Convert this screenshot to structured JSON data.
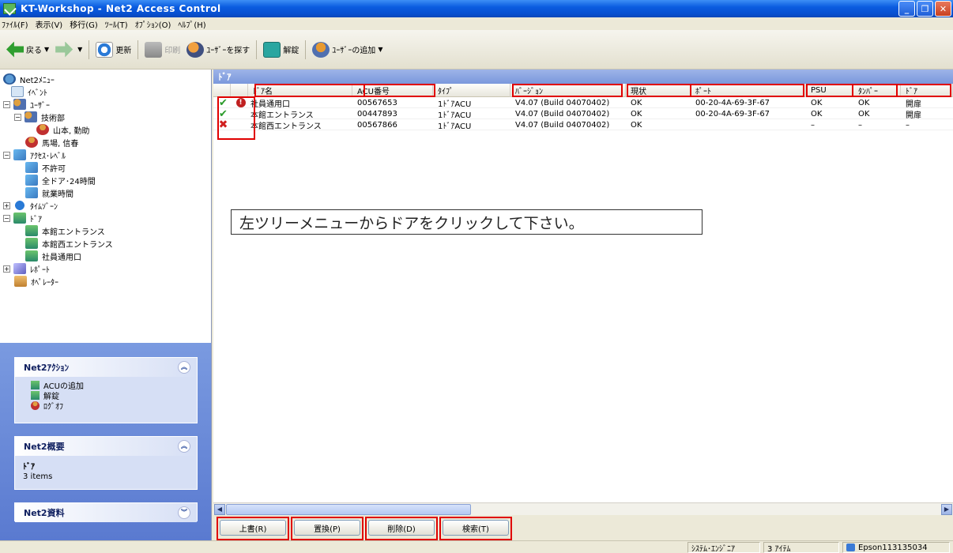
{
  "window": {
    "title": "KT-Workshop - Net2 Access Control"
  },
  "menubar": [
    "ﾌｧｲﾙ(F)",
    "表示(V)",
    "移行(G)",
    "ﾂｰﾙ(T)",
    "ｵﾌﾟｼｮﾝ(O)",
    "ﾍﾙﾌﾟ(H)"
  ],
  "toolbar": {
    "back": "戻る",
    "refresh": "更新",
    "print": "印刷",
    "find_user": "ﾕｰｻﾞｰを探す",
    "unlock": "解錠",
    "add_user": "ﾕｰｻﾞｰの追加"
  },
  "tree": {
    "root": "Net2ﾒﾆｭｰ",
    "event": "ｲﾍﾞﾝﾄ",
    "users": "ﾕｰｻﾞｰ",
    "tech_dept": "技術部",
    "user1": "山本, 勤助",
    "user2": "馬場, 信春",
    "access_level": "ｱｸｾｽ･ﾚﾍﾞﾙ",
    "al1": "不許可",
    "al2": "全ドア･24時間",
    "al3": "就業時間",
    "timezone": "ﾀｲﾑｿﾞｰﾝ",
    "doors": "ﾄﾞｱ",
    "door1": "本館エントランス",
    "door2": "本館西エントランス",
    "door3": "社員通用口",
    "report": "ﾚﾎﾟｰﾄ",
    "operator": "ｵﾍﾟﾚｰﾀｰ"
  },
  "actions": {
    "title": "Net2ｱｸｼｮﾝ",
    "items": [
      "ACUの追加",
      "解錠",
      "ﾛｸﾞｵﾌ"
    ]
  },
  "summary": {
    "title": "Net2概要",
    "heading": "ﾄﾞｱ",
    "count": "3 items"
  },
  "resources": {
    "title": "Net2資料"
  },
  "main": {
    "header": "ﾄﾞｱ",
    "columns": [
      "ﾄﾞｱ名",
      "ACU番号",
      "ﾀｲﾌﾟ",
      "ﾊﾞｰｼﾞｮﾝ",
      "現状",
      "ﾎﾟｰﾄ",
      "PSU",
      "ﾀﾝﾊﾟｰ",
      "ﾄﾞｱ"
    ],
    "rows": [
      {
        "name": "社員通用口",
        "acu": "00567653",
        "type": "1ﾄﾞｱACU",
        "version": "V4.07 (Build 04070402)",
        "status": "OK",
        "port": "00-20-4A-69-3F-67",
        "psu": "OK",
        "tamper": "OK",
        "door": "開扉"
      },
      {
        "name": "本館エントランス",
        "acu": "00447893",
        "type": "1ﾄﾞｱACU",
        "version": "V4.07 (Build 04070402)",
        "status": "OK",
        "port": "00-20-4A-69-3F-67",
        "psu": "OK",
        "tamper": "OK",
        "door": "開扉"
      },
      {
        "name": "本館西エントランス",
        "acu": "00567866",
        "type": "1ﾄﾞｱACU",
        "version": "V4.07 (Build 04070402)",
        "status": "OK",
        "port": "",
        "psu": "–",
        "tamper": "–",
        "door": "–"
      }
    ],
    "hint": "左ツリーメニューからドアをクリックして下さい。"
  },
  "buttons": {
    "overwrite": "上書(R)",
    "replace": "置換(P)",
    "delete": "削除(D)",
    "search": "検索(T)"
  },
  "statusbar": {
    "role": "ｼｽﾃﾑ･ｴﾝｼﾞﾆｱ",
    "items": "3 ｱｲﾃﾑ",
    "server": "Epson113135034"
  }
}
